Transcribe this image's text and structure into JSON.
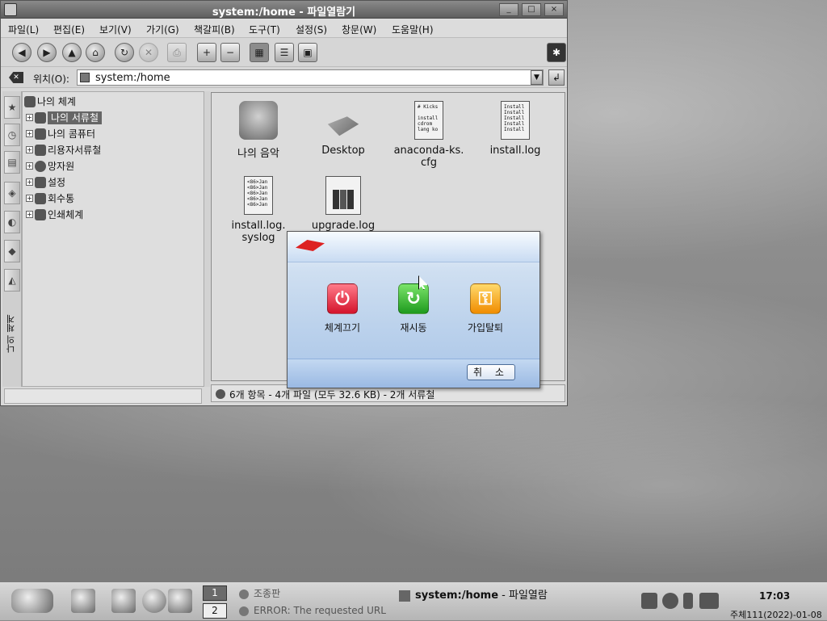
{
  "window": {
    "title": "system:/home - 파일열람기",
    "controls": [
      "_",
      "□",
      "×"
    ]
  },
  "menu": [
    "파일(L)",
    "편집(E)",
    "보기(V)",
    "가기(G)",
    "책갈피(B)",
    "도구(T)",
    "설정(S)",
    "창문(W)",
    "도움말(H)"
  ],
  "toolbar": {
    "back_icon": "back-arrow-icon",
    "forward_icon": "forward-arrow-icon",
    "up_icon": "up-arrow-icon",
    "home_icon": "home-icon",
    "reload_icon": "reload-icon",
    "stop_icon": "stop-icon",
    "print_icon": "print-icon",
    "zoom_in_icon": "zoom-in-icon",
    "zoom_out_icon": "zoom-out-icon"
  },
  "location": {
    "label": "위치(O):",
    "value": "system:/home"
  },
  "sidebar": {
    "vertical_label": "나의 체계"
  },
  "tree": {
    "root": "나의 체계",
    "items": [
      {
        "label": "나의 서류철",
        "selected": true
      },
      {
        "label": "나의 콤퓨터"
      },
      {
        "label": "리용자서류철"
      },
      {
        "label": "망자원"
      },
      {
        "label": "설정"
      },
      {
        "label": "회수통"
      },
      {
        "label": "인쇄체계"
      }
    ]
  },
  "files": [
    {
      "name": "나의 음악",
      "icon": "music-folder-icon"
    },
    {
      "name": "Desktop",
      "icon": "desktop-folder-icon"
    },
    {
      "name": "anaconda-ks.\ncfg",
      "icon": "text-file-icon",
      "preview": "# Kicks\n\ninstall\ncdrom\nlang ko"
    },
    {
      "name": "install.log",
      "icon": "text-file-icon",
      "preview": "Install\nInstall\nInstall\nInstall\nInstall"
    },
    {
      "name": "install.log.\nsyslog",
      "icon": "text-file-icon",
      "preview": "<86>Jan\n<86>Jan\n<86>Jan\n<86>Jan\n<86>Jan"
    },
    {
      "name": "upgrade.log",
      "icon": "chart-file-icon"
    }
  ],
  "status": "6개 항목 - 4개 파일 (모두 32.6 KB) - 2개 서류철",
  "dialog": {
    "buttons": [
      {
        "label": "체계끄기",
        "icon": "power-icon",
        "color": "#d4132b"
      },
      {
        "label": "재시동",
        "icon": "restart-icon",
        "color": "#1e9a1e"
      },
      {
        "label": "가입탈퇴",
        "icon": "key-icon",
        "color": "#f08c00"
      }
    ],
    "cancel": "취 소"
  },
  "taskbar": {
    "pager": [
      "1",
      "2"
    ],
    "tasks": [
      "조종판",
      "ERROR: The requested URL"
    ],
    "active_task_bold": "system:/home",
    "active_task_rest": " - 파일열람",
    "clock": "17:03",
    "date": "주체111(2022)-01-08"
  }
}
